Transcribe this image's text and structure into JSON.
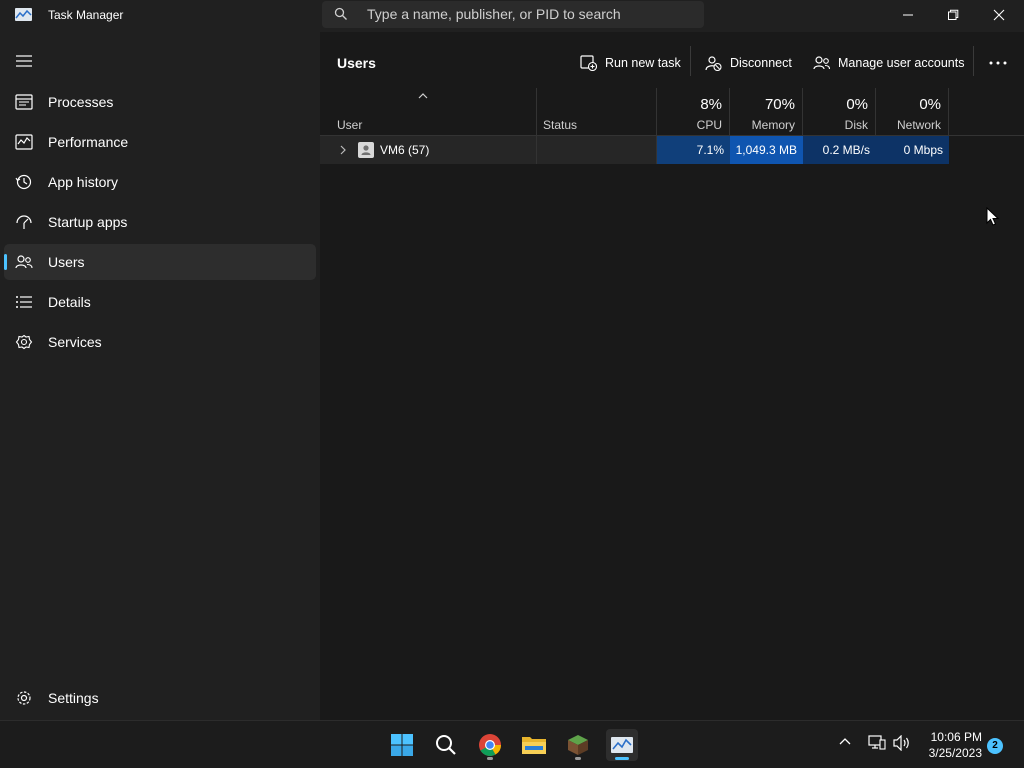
{
  "window": {
    "title": "Task Manager",
    "search_placeholder": "Type a name, publisher, or PID to search"
  },
  "sidebar": {
    "items": [
      {
        "label": "Processes",
        "icon": "processes-icon"
      },
      {
        "label": "Performance",
        "icon": "performance-icon"
      },
      {
        "label": "App history",
        "icon": "app-history-icon"
      },
      {
        "label": "Startup apps",
        "icon": "startup-apps-icon"
      },
      {
        "label": "Users",
        "icon": "users-icon",
        "active": true
      },
      {
        "label": "Details",
        "icon": "details-icon"
      },
      {
        "label": "Services",
        "icon": "services-icon"
      }
    ],
    "settings_label": "Settings"
  },
  "page": {
    "title": "Users",
    "commands": {
      "run_new_task": "Run new task",
      "disconnect": "Disconnect",
      "manage_user_accounts": "Manage user accounts"
    }
  },
  "table": {
    "columns": {
      "user": "User",
      "status": "Status",
      "cpu": {
        "pct": "8%",
        "label": "CPU"
      },
      "memory": {
        "pct": "70%",
        "label": "Memory"
      },
      "disk": {
        "pct": "0%",
        "label": "Disk"
      },
      "network": {
        "pct": "0%",
        "label": "Network"
      }
    },
    "rows": [
      {
        "user": "VM6 (57)",
        "status": "",
        "cpu": "7.1%",
        "memory": "1,049.3 MB",
        "disk": "0.2 MB/s",
        "network": "0 Mbps"
      }
    ]
  },
  "taskbar": {
    "time": "10:06 PM",
    "date": "3/25/2023",
    "notifications": "2"
  },
  "colors": {
    "accent": "#4cc2ff",
    "cpu_heat": "#103f7a",
    "memory_heat": "#0f55b0",
    "disk_heat": "#0d3366",
    "network_heat": "#0d3366"
  }
}
